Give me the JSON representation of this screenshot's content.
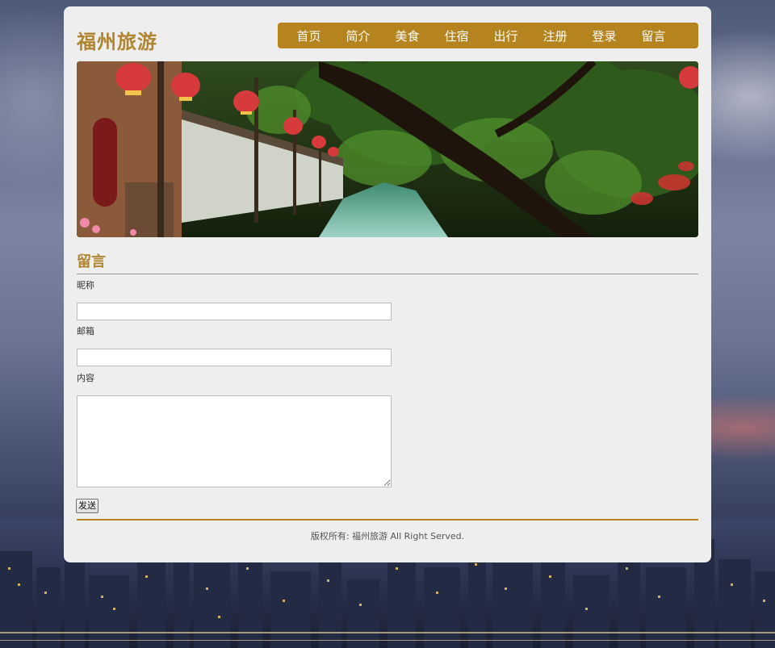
{
  "site": {
    "title": "福州旅游"
  },
  "nav": {
    "items": [
      {
        "label": "首页"
      },
      {
        "label": "简介"
      },
      {
        "label": "美食"
      },
      {
        "label": "住宿"
      },
      {
        "label": "出行"
      },
      {
        "label": "注册"
      },
      {
        "label": "登录"
      },
      {
        "label": "留言"
      }
    ]
  },
  "banner": {
    "image": "canal-with-red-lanterns-and-trees"
  },
  "form": {
    "section_title": "留言",
    "nickname_label": "昵称",
    "nickname_value": "",
    "email_label": "邮箱",
    "email_value": "",
    "content_label": "内容",
    "content_value": "",
    "submit_label": "发送"
  },
  "footer": {
    "copyright": "版权所有: 福州旅游 All Right Served."
  },
  "colors": {
    "accent": "#b5841e",
    "title": "#b08530",
    "panel": "#eeeeee"
  }
}
